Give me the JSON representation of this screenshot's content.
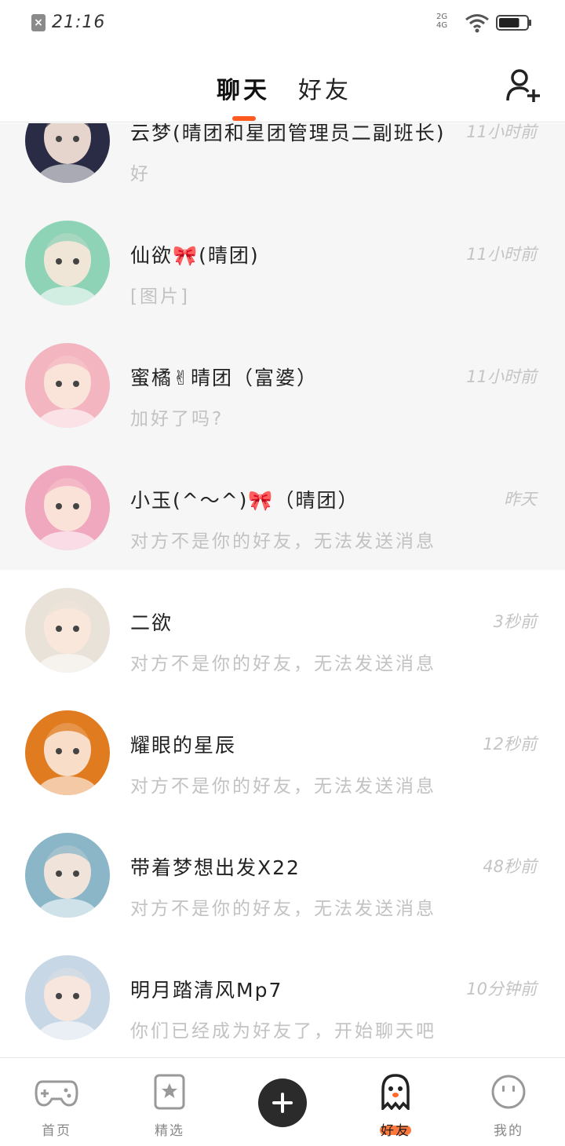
{
  "status_bar": {
    "time": "21:16",
    "network_label": "2G 4G",
    "battery_level": 0.75
  },
  "header": {
    "tabs": [
      {
        "label": "聊天",
        "active": true
      },
      {
        "label": "好友",
        "active": false
      }
    ]
  },
  "conversations": [
    {
      "name": "云梦(晴团和星团管理员二副班长)",
      "time": "11小时前",
      "preview": "好",
      "pinned": true,
      "avatar": "#2a2c45"
    },
    {
      "name": "仙欲🎀(晴团)",
      "time": "11小时前",
      "preview": "[图片]",
      "pinned": true,
      "avatar": "#8fd3b7"
    },
    {
      "name": "蜜橘✌晴团（富婆）",
      "time": "11小时前",
      "preview": "加好了吗?",
      "pinned": true,
      "avatar": "#f3b6c0"
    },
    {
      "name": "小玉(^～^)🎀（晴团）",
      "time": "昨天",
      "preview": "对方不是你的好友，无法发送消息",
      "pinned": true,
      "avatar": "#f0a8bf"
    },
    {
      "name": "二欲",
      "time": "3秒前",
      "preview": "对方不是你的好友，无法发送消息",
      "pinned": false,
      "avatar": "#e8e2d8"
    },
    {
      "name": "耀眼的星辰",
      "time": "12秒前",
      "preview": "对方不是你的好友，无法发送消息",
      "pinned": false,
      "avatar": "#e07b1f"
    },
    {
      "name": "带着梦想出发X22",
      "time": "48秒前",
      "preview": "对方不是你的好友，无法发送消息",
      "pinned": false,
      "avatar": "#8ab6c8"
    },
    {
      "name": "明月踏清风Mp7",
      "time": "10分钟前",
      "preview": "你们已经成为好友了，开始聊天吧",
      "pinned": false,
      "avatar": "#c7d7e6"
    }
  ],
  "bottom_nav": {
    "items": [
      {
        "label": "首页",
        "icon": "gamepad-icon"
      },
      {
        "label": "精选",
        "icon": "bookmark-star-icon"
      },
      {
        "label": "",
        "icon": "plus-icon"
      },
      {
        "label": "好友",
        "icon": "ghost-icon",
        "active": true
      },
      {
        "label": "我的",
        "icon": "smiley-face-icon"
      }
    ]
  },
  "colors": {
    "accent": "#ff5a1f",
    "pinned_bg": "#f6f6f6",
    "muted_text": "#c2c2c2"
  }
}
